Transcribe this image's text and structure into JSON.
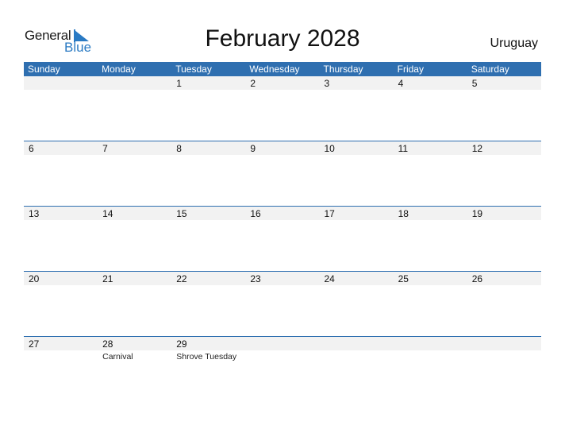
{
  "logo": {
    "word1": "General",
    "word2": "Blue"
  },
  "header": {
    "title": "February 2028",
    "country": "Uruguay"
  },
  "colors": {
    "accent": "#2f6fb0",
    "strip": "#f2f2f2",
    "logo_blue": "#2a7ac3"
  },
  "weekdays": [
    "Sunday",
    "Monday",
    "Tuesday",
    "Wednesday",
    "Thursday",
    "Friday",
    "Saturday"
  ],
  "weeks": [
    {
      "days": [
        {
          "num": ""
        },
        {
          "num": ""
        },
        {
          "num": "1"
        },
        {
          "num": "2"
        },
        {
          "num": "3"
        },
        {
          "num": "4"
        },
        {
          "num": "5"
        }
      ]
    },
    {
      "days": [
        {
          "num": "6"
        },
        {
          "num": "7"
        },
        {
          "num": "8"
        },
        {
          "num": "9"
        },
        {
          "num": "10"
        },
        {
          "num": "11"
        },
        {
          "num": "12"
        }
      ]
    },
    {
      "days": [
        {
          "num": "13"
        },
        {
          "num": "14"
        },
        {
          "num": "15"
        },
        {
          "num": "16"
        },
        {
          "num": "17"
        },
        {
          "num": "18"
        },
        {
          "num": "19"
        }
      ]
    },
    {
      "days": [
        {
          "num": "20"
        },
        {
          "num": "21"
        },
        {
          "num": "22"
        },
        {
          "num": "23"
        },
        {
          "num": "24"
        },
        {
          "num": "25"
        },
        {
          "num": "26"
        }
      ]
    },
    {
      "days": [
        {
          "num": "27"
        },
        {
          "num": "28",
          "event": "Carnival"
        },
        {
          "num": "29",
          "event": "Shrove Tuesday"
        },
        {
          "num": ""
        },
        {
          "num": ""
        },
        {
          "num": ""
        },
        {
          "num": ""
        }
      ]
    }
  ]
}
